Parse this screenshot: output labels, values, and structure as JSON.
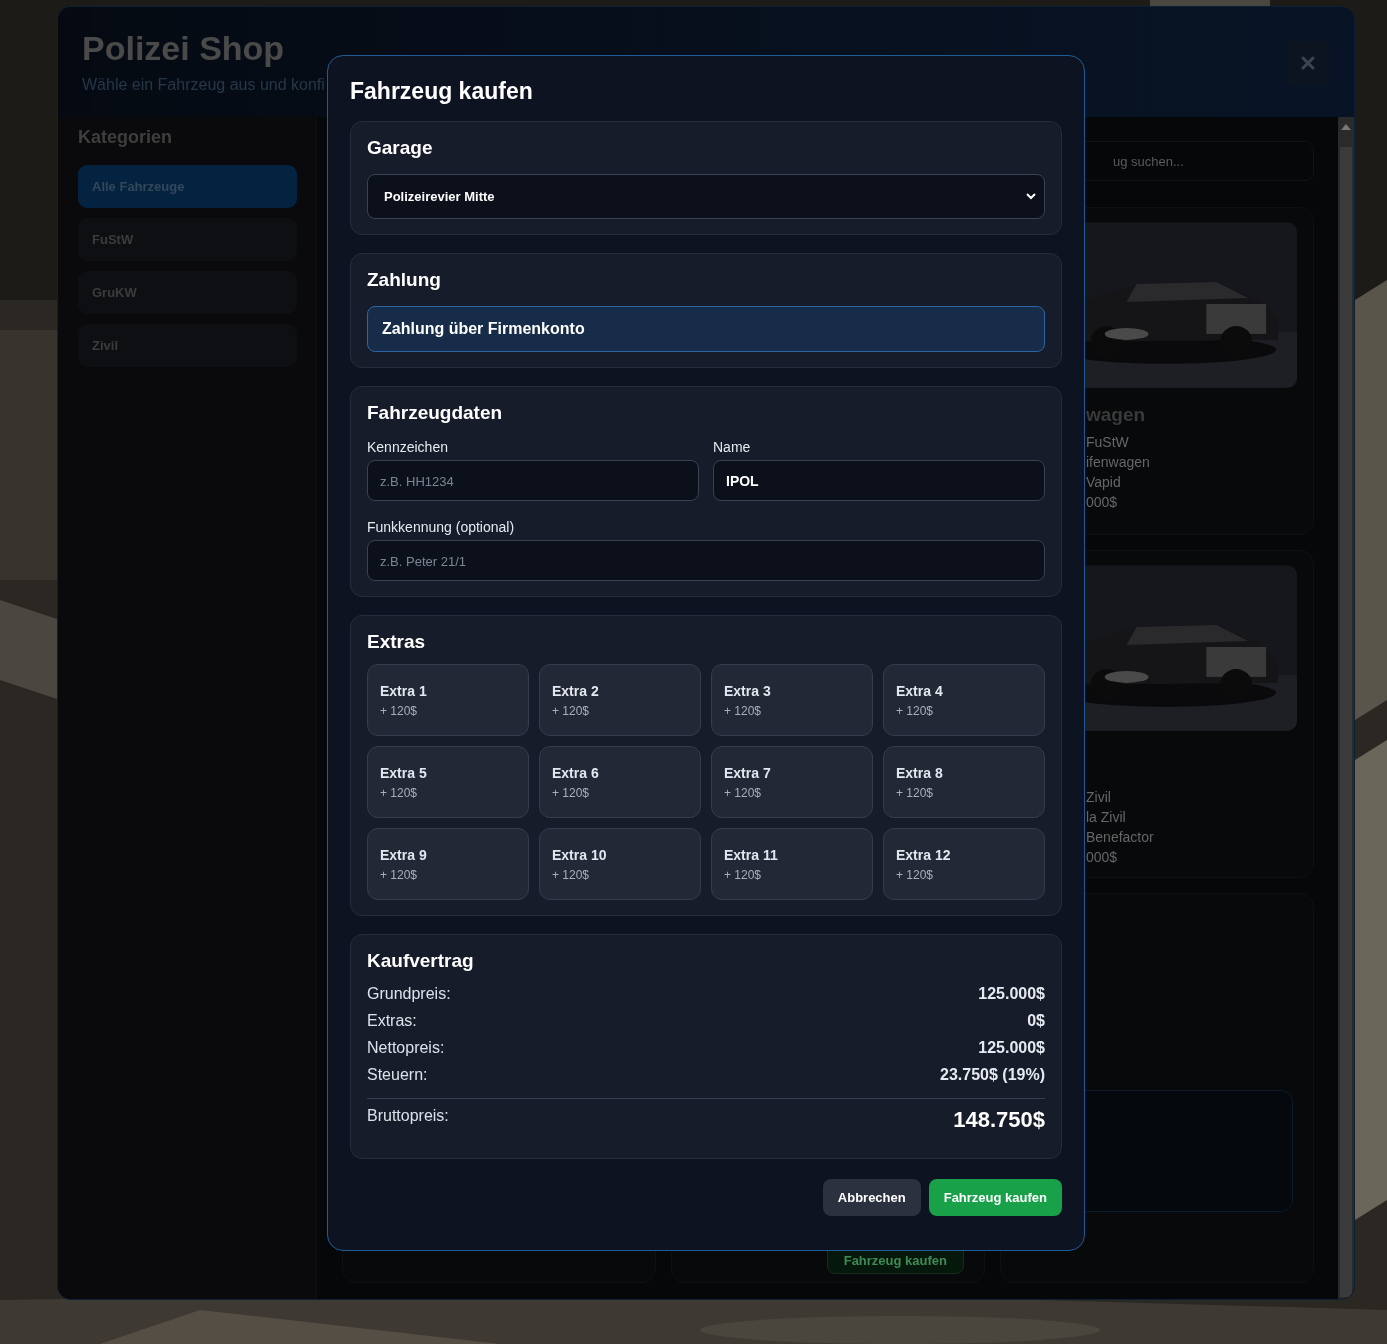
{
  "shop": {
    "title": "Polizei Shop",
    "subtitle": "Wähle ein Fahrzeug aus und konfi"
  },
  "sidebar": {
    "title": "Kategorien",
    "items": [
      {
        "label": "Alle Fahrzeuge",
        "selected": true
      },
      {
        "label": "FuStW",
        "selected": false
      },
      {
        "label": "GruKW",
        "selected": false
      },
      {
        "label": "Zivil",
        "selected": false
      }
    ]
  },
  "search": {
    "placeholder": "ug suchen..."
  },
  "vehicle_cards": [
    {
      "title": "wagen",
      "lines": [
        "FuStW",
        "ifenwagen",
        "Vapid",
        "000$"
      ]
    },
    {
      "lines": [
        "Zivil",
        "la Zivil",
        "Benefactor",
        "000$"
      ]
    }
  ],
  "hidden_card_button": "Fahrzeug kaufen",
  "modal": {
    "title": "Fahrzeug kaufen",
    "garage": {
      "title": "Garage",
      "value": "Polizeirevier Mitte"
    },
    "payment": {
      "title": "Zahlung",
      "options": [
        {
          "label": "Zahlung über Firmenkonto",
          "selected": true
        }
      ]
    },
    "vehicle_data": {
      "title": "Fahrzeugdaten",
      "fields": [
        {
          "label": "Kennzeichen",
          "placeholder": "z.B. HH1234"
        },
        {
          "label": "Name",
          "value": "IPOL"
        },
        {
          "label": "Funkkennung (optional)",
          "placeholder": "z.B. Peter 21/1"
        }
      ]
    },
    "extras": {
      "title": "Extras",
      "items": [
        {
          "name": "Extra 1",
          "price": "+ 120$",
          "checked": false
        },
        {
          "name": "Extra 2",
          "price": "+ 120$",
          "checked": false
        },
        {
          "name": "Extra 3",
          "price": "+ 120$",
          "checked": false
        },
        {
          "name": "Extra 4",
          "price": "+ 120$",
          "checked": false
        },
        {
          "name": "Extra 5",
          "price": "+ 120$",
          "checked": false
        },
        {
          "name": "Extra 6",
          "price": "+ 120$",
          "checked": false
        },
        {
          "name": "Extra 7",
          "price": "+ 120$",
          "checked": false
        },
        {
          "name": "Extra 8",
          "price": "+ 120$",
          "checked": false
        },
        {
          "name": "Extra 9",
          "price": "+ 120$",
          "checked": false
        },
        {
          "name": "Extra 10",
          "price": "+ 120$",
          "checked": false
        },
        {
          "name": "Extra 11",
          "price": "+ 120$",
          "checked": false
        },
        {
          "name": "Extra 12",
          "price": "+ 120$",
          "checked": false
        }
      ]
    },
    "contract": {
      "title": "Kaufvertrag",
      "rows": [
        {
          "kind": "line",
          "label": "Grundpreis:",
          "value": "125.000$"
        },
        {
          "kind": "line",
          "label": "Extras:",
          "value": "0$"
        },
        {
          "kind": "line",
          "label": "Nettopreis:",
          "value": "125.000$"
        },
        {
          "kind": "line",
          "label": "Steuern:",
          "value": "23.750$ (19%)"
        },
        {
          "kind": "total",
          "label": "Bruttopreis:",
          "value": "148.750$"
        }
      ]
    },
    "buttons": [
      {
        "kind": "secondary",
        "label": "Abbrechen"
      },
      {
        "kind": "primary",
        "label": "Fahrzeug kaufen"
      }
    ]
  }
}
